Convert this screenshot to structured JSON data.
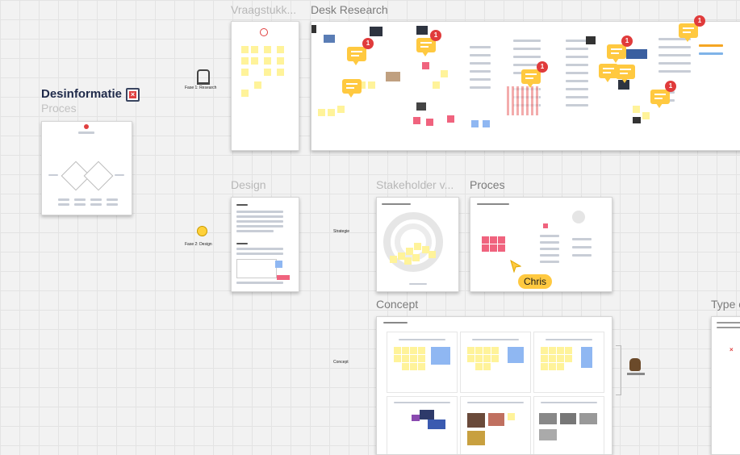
{
  "board": {
    "title": "Desinformatie",
    "subtitle": "Proces"
  },
  "phases": {
    "research": "Fase 1: Research",
    "design": "Fase 2: Design"
  },
  "sections": {
    "strategie": "Strategie",
    "concept": "Concept"
  },
  "frames": {
    "vraagstuk": "Vraagstukk...",
    "desk_research": "Desk Research",
    "design": "Design",
    "stakeholder": "Stakeholder v...",
    "proces": "Proces",
    "concept": "Concept",
    "type": "Type o"
  },
  "comments": {
    "badge": "1"
  },
  "cursor": {
    "user": "Chris"
  },
  "colors": {
    "sticky_yellow": "#fff39a",
    "sticky_pink": "#f0637e",
    "sticky_blue": "#8fb7f2",
    "comment": "#ffc940",
    "badge": "#e03b3b",
    "cursor": "#ffc940"
  }
}
